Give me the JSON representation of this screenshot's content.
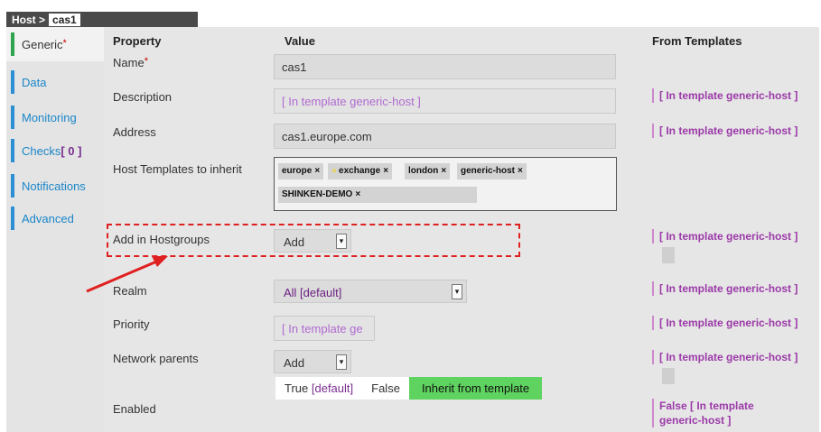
{
  "breadcrumb": {
    "prefix": "Host >",
    "name": "cas1"
  },
  "tabs": [
    {
      "label": "Generic",
      "required": "*"
    },
    {
      "label": "Data"
    },
    {
      "label": "Monitoring"
    },
    {
      "label": "Checks",
      "badge": "[ 0 ]"
    },
    {
      "label": "Notifications"
    },
    {
      "label": "Advanced"
    }
  ],
  "headers": {
    "property": "Property",
    "value": "Value",
    "from_templates": "From Templates"
  },
  "rows": {
    "name": {
      "label": "Name",
      "required": "*",
      "value": "cas1"
    },
    "description": {
      "label": "Description",
      "placeholder": "[ In template generic-host ]",
      "from": "[ In template generic-host ]"
    },
    "address": {
      "label": "Address",
      "value": "cas1.europe.com",
      "from": "[ In template generic-host ]"
    },
    "templates": {
      "label": "Host Templates to inherit",
      "chips": [
        "europe",
        "exchange",
        "london",
        "generic-host",
        "SHINKEN-DEMO"
      ],
      "remove": "×"
    },
    "hostgroups": {
      "label": "Add in Hostgroups",
      "select": "Add",
      "from": "[ In template generic-host ]"
    },
    "realm": {
      "label": "Realm",
      "select": "All [default]",
      "from": "[ In template generic-host ]"
    },
    "priority": {
      "label": "Priority",
      "placeholder": "[ In template ge",
      "from": "[ In template generic-host ]"
    },
    "parents": {
      "label": "Network parents",
      "select": "Add",
      "from": "[ In template generic-host ]"
    },
    "enabled": {
      "label": "Enabled",
      "true_label": "True",
      "true_default": "[default]",
      "false_label": "False",
      "inherit_label": "Inherit from template",
      "from_line1": "False [ In template",
      "from_line2": "generic-host ]"
    }
  },
  "colors": {
    "active_tab_bar": "#2ea44f",
    "tab_bar": "#2c8fd3",
    "inherit_green": "#5fd35f",
    "template_purple": "#9b3aa8",
    "highlight_red": "#e02020"
  }
}
